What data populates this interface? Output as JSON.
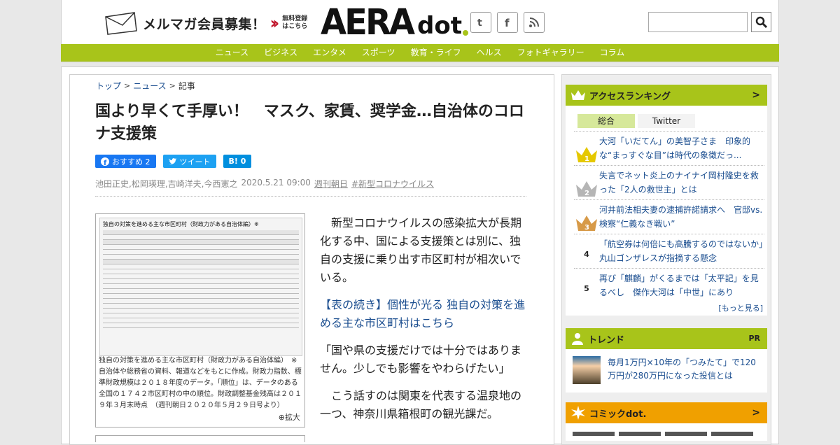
{
  "header": {
    "mailmag_text": "メルマガ会員募集！",
    "register_text": "無料登録はこちら",
    "logo_main": "AERA",
    "logo_sub": "dot",
    "search_placeholder": ""
  },
  "nav": {
    "items": [
      "ニュース",
      "ビジネス",
      "エンタメ",
      "スポーツ",
      "教育・ライフ",
      "ヘルス",
      "フォトギャラリー",
      "コラム"
    ]
  },
  "breadcrumb": {
    "items": [
      "トップ",
      "ニュース",
      "記事"
    ]
  },
  "article": {
    "title": "国より早くて手厚い！　マスク、家賃、奨学金…自治体のコロナ支援策",
    "share": {
      "fb_label": "おすすめ 2",
      "tw_label": "ツイート",
      "hb_label": "B! 0"
    },
    "authors": "池田正史,松岡瑛理,吉崎洋夫,今西憲之",
    "date": "2020.5.21 09:00",
    "source": "週刊朝日",
    "tag": "#新型コロナウイルス",
    "figure": {
      "header_text": "独自の対策を進める主な市区町村（財政力がある自治体編）※",
      "caption": "独自の対策を進める主な市区町村（財政力がある自治体編）　※自治体や総務省の資料、報道などをもとに作成。財政力指数、標準財政規模は２０１８年度のデータ。「順位」は、データのある全国の１７４２市区町村の中の順位。財政調整基金残高は２０１９年３月末時点　（週刊朝日２０２０年５月２９日号より）",
      "zoom_label": "拡大"
    },
    "paragraphs": [
      "新型コロナウイルスの感染拡大が長期化する中、国による支援策とは別に、独自の支援に乗り出す市区町村が相次いでいる。",
      "【表の続き】個性が光る 独自の対策を進める主な市区町村はこちら",
      "「国や県の支援だけでは十分ではありません。少しでも影響をやわらげたい」",
      "こう話すのは関東を代表する温泉地の一つ、神奈川県箱根町の観光課だ。"
    ]
  },
  "sidebar": {
    "ranking": {
      "title": "アクセスランキング",
      "tabs": [
        "総合",
        "Twitter"
      ],
      "items": [
        {
          "rank": "1",
          "text": "大河「いだてん」の美智子さま　印象的な“まっすぐな目”は時代の象徴だっ..."
        },
        {
          "rank": "2",
          "text": "失言でネット炎上のナイナイ岡村隆史を救った「2人の救世主」とは"
        },
        {
          "rank": "3",
          "text": "河井前法相夫妻の逮捕許諾請求へ　官邸vs.検察“仁義なき戦い”"
        },
        {
          "rank": "4",
          "text": "「航空券は何倍にも高騰するのではないか」丸山ゴンザレスが指摘する懸念"
        },
        {
          "rank": "5",
          "text": "再び「麒麟」がくるまでは「太平記」を見るべし　傑作大河は「中世」にあり"
        }
      ],
      "more_label": "[もっと見る]"
    },
    "trend": {
      "title": "トレンド",
      "pr_label": "PR",
      "item_text": "毎月1万円×10年の「つみたて」で120万円が280万円になった投信とは"
    },
    "comic": {
      "title": "コミックdot."
    }
  },
  "colors": {
    "accent_green": "#a8c41a",
    "comic_orange": "#f0a000",
    "link_blue": "#1a4d8f"
  }
}
